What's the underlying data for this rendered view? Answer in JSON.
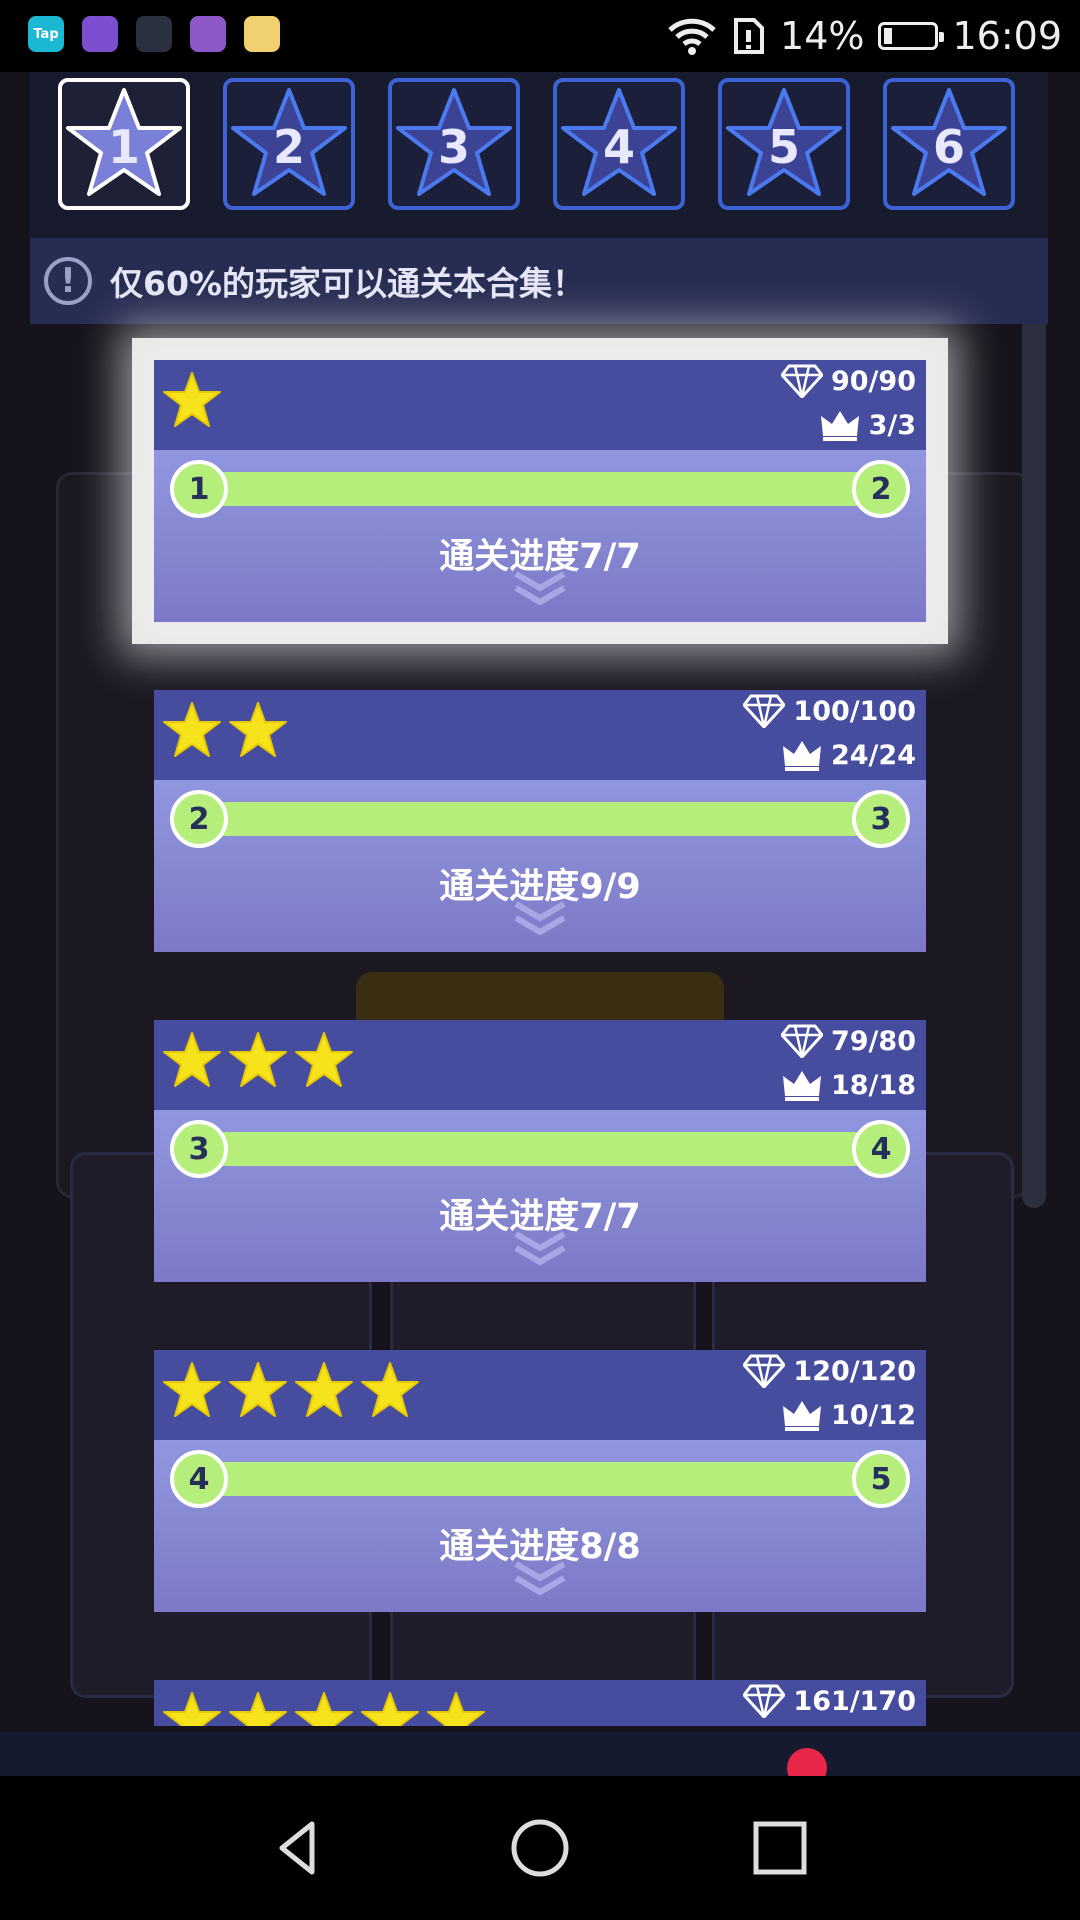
{
  "status_bar": {
    "apps": [
      {
        "icon": "taptap-icon",
        "label": "Tap",
        "color": "#1bb8d4"
      },
      {
        "icon": "globe-app-icon",
        "label": "",
        "color": "#7b4fd0"
      },
      {
        "icon": "game-app-icon",
        "label": "",
        "color": "#2a3040"
      },
      {
        "icon": "gallery-icon",
        "label": "",
        "color": "#8e57c8"
      },
      {
        "icon": "star-app-icon",
        "label": "",
        "color": "#f0d070"
      }
    ],
    "battery_percent": "14%",
    "time": "16:09"
  },
  "tabs": [
    {
      "label": "1",
      "active": true
    },
    {
      "label": "2",
      "active": false
    },
    {
      "label": "3",
      "active": false
    },
    {
      "label": "4",
      "active": false
    },
    {
      "label": "5",
      "active": false
    },
    {
      "label": "6",
      "active": false
    }
  ],
  "info": {
    "icon": "exclamation-icon",
    "text": "仅60%的玩家可以通关本合集！"
  },
  "levels": [
    {
      "stars": 1,
      "gems": "90/90",
      "crowns": "3/3",
      "from": "1",
      "to": "2",
      "progress": "通关进度7/7",
      "highlight": true
    },
    {
      "stars": 2,
      "gems": "100/100",
      "crowns": "24/24",
      "from": "2",
      "to": "3",
      "progress": "通关进度9/9",
      "highlight": false
    },
    {
      "stars": 3,
      "gems": "79/80",
      "crowns": "18/18",
      "from": "3",
      "to": "4",
      "progress": "通关进度7/7",
      "highlight": false
    },
    {
      "stars": 4,
      "gems": "120/120",
      "crowns": "10/12",
      "from": "4",
      "to": "5",
      "progress": "通关进度8/8",
      "highlight": false
    },
    {
      "stars": 5,
      "gems": "161/170",
      "crowns": "",
      "from": "",
      "to": "",
      "progress": "",
      "highlight": false
    }
  ],
  "colors": {
    "card_header": "#474d9e",
    "card_body": "#8a8ad6",
    "progress_bar": "#b5ee7a",
    "star": "#f7e31c",
    "tab_border": "#3c63d6"
  }
}
